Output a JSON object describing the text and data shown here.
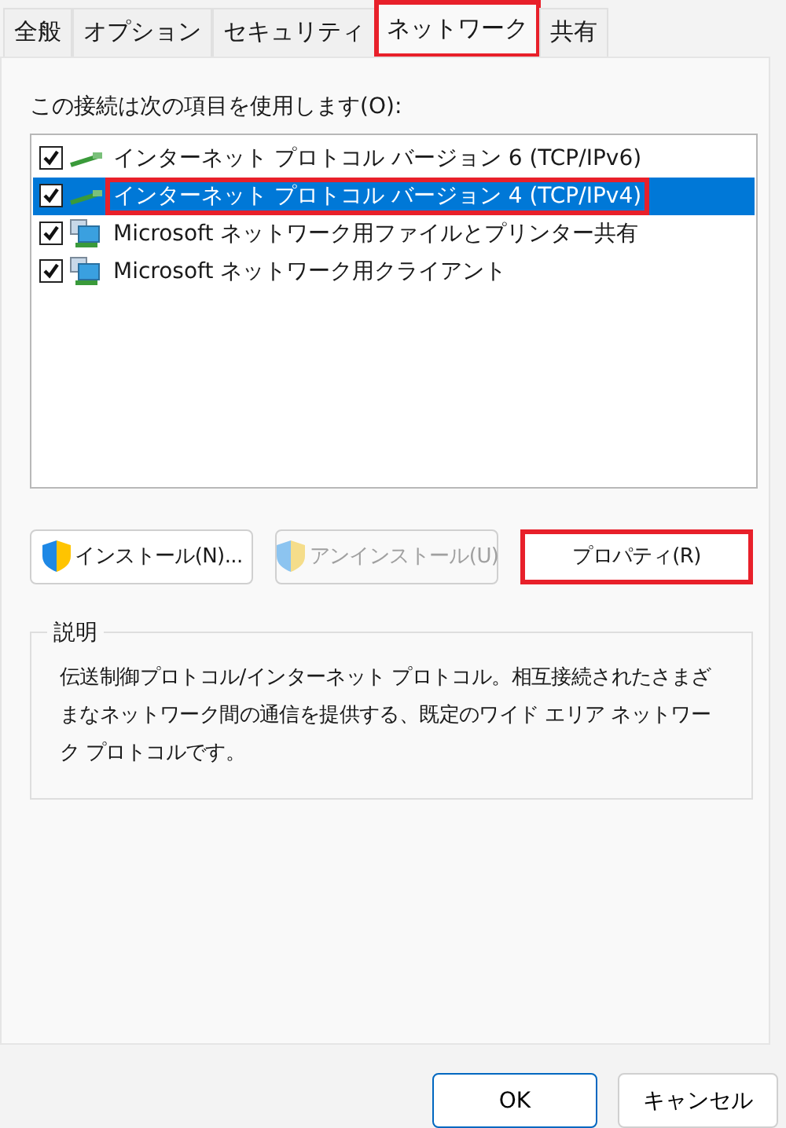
{
  "tabs": [
    {
      "label": "全般",
      "selected": false,
      "highlighted": false
    },
    {
      "label": "オプション",
      "selected": false,
      "highlighted": false
    },
    {
      "label": "セキュリティ",
      "selected": false,
      "highlighted": false
    },
    {
      "label": "ネットワーク",
      "selected": true,
      "highlighted": true
    },
    {
      "label": "共有",
      "selected": false,
      "highlighted": false
    }
  ],
  "components_label": "この接続は次の項目を使用します(O):",
  "components": [
    {
      "label": "インターネット プロトコル バージョン 6 (TCP/IPv6)",
      "kind": "protocol",
      "checked": true,
      "selected": false,
      "highlighted": false
    },
    {
      "label": "インターネット プロトコル バージョン 4 (TCP/IPv4)",
      "kind": "protocol",
      "checked": true,
      "selected": true,
      "highlighted": true
    },
    {
      "label": "Microsoft ネットワーク用ファイルとプリンター共有",
      "kind": "service",
      "checked": true,
      "selected": false,
      "highlighted": false
    },
    {
      "label": "Microsoft ネットワーク用クライアント",
      "kind": "service",
      "checked": true,
      "selected": false,
      "highlighted": false
    }
  ],
  "actions": [
    {
      "label": "インストール(N)...",
      "shield": true,
      "disabled": false,
      "highlighted": false
    },
    {
      "label": "アンインストール(U)",
      "shield": true,
      "disabled": true,
      "highlighted": false
    },
    {
      "label": "プロパティ(R)",
      "shield": false,
      "disabled": false,
      "highlighted": true
    }
  ],
  "description": {
    "title": "説明",
    "text": "伝送制御プロトコル/インターネット プロトコル。相互接続されたさまざまなネットワーク間の通信を提供する、既定のワイド エリア ネットワーク プロトコルです。"
  },
  "footer_buttons": [
    {
      "label": "OK",
      "default": true
    },
    {
      "label": "キャンセル",
      "default": false
    }
  ]
}
